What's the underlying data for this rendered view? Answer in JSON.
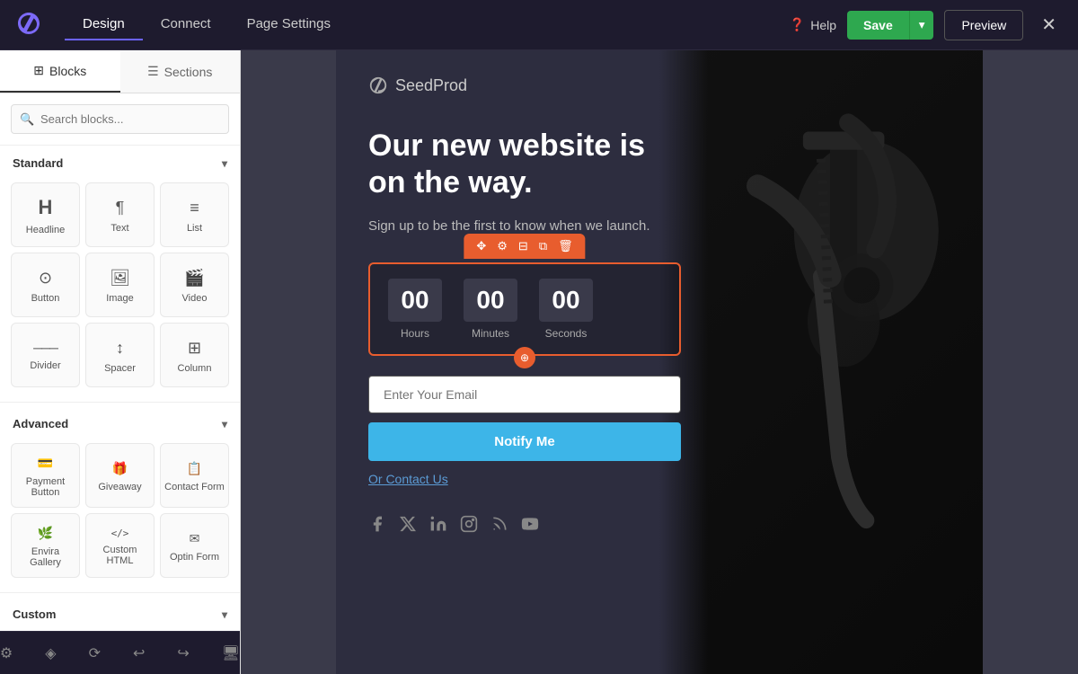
{
  "nav": {
    "tabs": [
      {
        "id": "design",
        "label": "Design",
        "active": true
      },
      {
        "id": "connect",
        "label": "Connect",
        "active": false
      },
      {
        "id": "page_settings",
        "label": "Page Settings",
        "active": false
      }
    ],
    "help_label": "Help",
    "save_label": "Save",
    "preview_label": "Preview"
  },
  "left_panel": {
    "tab_blocks": "Blocks",
    "tab_sections": "Sections",
    "search_placeholder": "Search blocks...",
    "standard_section": "Standard",
    "advanced_section": "Advanced",
    "standard_blocks": [
      {
        "id": "headline",
        "label": "Headline",
        "icon": "H"
      },
      {
        "id": "text",
        "label": "Text",
        "icon": "¶"
      },
      {
        "id": "list",
        "label": "List",
        "icon": "≡"
      },
      {
        "id": "button",
        "label": "Button",
        "icon": "⊙"
      },
      {
        "id": "image",
        "label": "Image",
        "icon": "▭"
      },
      {
        "id": "video",
        "label": "Video",
        "icon": "▶"
      },
      {
        "id": "divider",
        "label": "Divider",
        "icon": "—"
      },
      {
        "id": "spacer",
        "label": "Spacer",
        "icon": "↕"
      },
      {
        "id": "column",
        "label": "Column",
        "icon": "⊞"
      }
    ],
    "advanced_blocks": [
      {
        "id": "payment_button",
        "label": "Payment Button",
        "icon": "💳"
      },
      {
        "id": "giveaway",
        "label": "Giveaway",
        "icon": "🎁"
      },
      {
        "id": "contact_form",
        "label": "Contact Form",
        "icon": "📋"
      },
      {
        "id": "envira_gallery",
        "label": "Envira Gallery",
        "icon": "🖼"
      },
      {
        "id": "custom_html",
        "label": "Custom HTML",
        "icon": "</>"
      },
      {
        "id": "optin_form",
        "label": "Optin Form",
        "icon": "✉"
      }
    ],
    "custom_label": "Custom"
  },
  "canvas": {
    "logo_text": "SeedProd",
    "hero_heading": "Our new website is on the way.",
    "hero_sub": "Sign up to be the first to know when we launch.",
    "countdown": {
      "hours": "00",
      "hours_label": "Hours",
      "minutes": "00",
      "minutes_label": "Minutes",
      "seconds": "00",
      "seconds_label": "Seconds"
    },
    "email_placeholder": "Enter Your Email",
    "notify_label": "Notify Me",
    "contact_link": "Or Contact Us",
    "social_icons": [
      "facebook",
      "x-twitter",
      "linkedin",
      "instagram",
      "rss",
      "youtube"
    ]
  },
  "colors": {
    "accent_orange": "#e85d2e",
    "accent_green": "#2ea84f",
    "accent_blue": "#3db5e8"
  }
}
